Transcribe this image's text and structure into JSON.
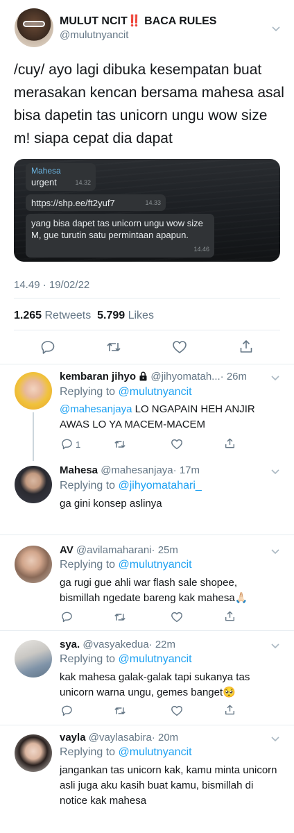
{
  "main_tweet": {
    "display_name": "MULUT NCIT",
    "name_suffix": "‼️",
    "name_tail": " BACA RULES",
    "handle": "@mulutnyancit",
    "text": "/cuy/ ayo lagi dibuka kesempatan buat merasakan kencan bersama mahesa asal bisa dapetin tas unicorn ungu wow size m! siapa cepat dia dapat",
    "chat_media": {
      "sender": "Mahesa",
      "messages": [
        {
          "text": "urgent",
          "time": "14.32"
        },
        {
          "text": "https://shp.ee/ft2yuf7",
          "time": "14.33"
        },
        {
          "text": "yang bisa dapet tas unicorn ungu wow size M, gue turutin satu permintaan apapun.",
          "time": "14.46"
        }
      ]
    },
    "timestamp": "14.49 · 19/02/22",
    "retweets_count": "1.265",
    "retweets_label": "Retweets",
    "likes_count": "5.799",
    "likes_label": "Likes"
  },
  "actions": {
    "reply_icon": "reply-icon",
    "retweet_icon": "retweet-icon",
    "like_icon": "heart-icon",
    "share_icon": "share-icon"
  },
  "replies": [
    {
      "name": "kembaran jihyo",
      "lock_icon": "lock-icon",
      "handle": "@jihyomatah...",
      "time": "· 26m",
      "replying_label": "Replying to",
      "replying_to": "@mulutnyancit",
      "mention": "@mahesanjaya",
      "text": " LO NGAPAIN HEH ANJIR AWAS LO YA MACEM-MACEM",
      "reply_count": "1"
    },
    {
      "name": "Mahesa",
      "handle": "@mahesanjaya",
      "time": "· 17m",
      "replying_label": "Replying to",
      "replying_to": "@jihyomatahari_",
      "text": "ga gini konsep aslinya"
    },
    {
      "name": "AV",
      "handle": "@avilamaharani",
      "time": "· 25m",
      "replying_label": "Replying to",
      "replying_to": "@mulutnyancit",
      "text": "ga rugi gue ahli war flash sale shopee, bismillah ngedate bareng kak mahesa🙏🏻"
    },
    {
      "name": "sya.",
      "handle": "@vasyakedua",
      "time": "· 22m",
      "replying_label": "Replying to",
      "replying_to": "@mulutnyancit",
      "text": "kak mahesa galak-galak tapi sukanya tas unicorn warna ungu, gemes banget🥺"
    },
    {
      "name": "vayla",
      "handle": "@vaylasabira",
      "time": "· 20m",
      "replying_label": "Replying to",
      "replying_to": "@mulutnyancit",
      "text": "jangankan tas unicorn kak, kamu minta unicorn asli juga aku kasih buat kamu, bismillah di notice kak mahesa"
    }
  ],
  "colors": {
    "accent": "#1da1f2",
    "text": "#14171a",
    "secondary": "#657786",
    "divider": "#e6ecf0"
  }
}
